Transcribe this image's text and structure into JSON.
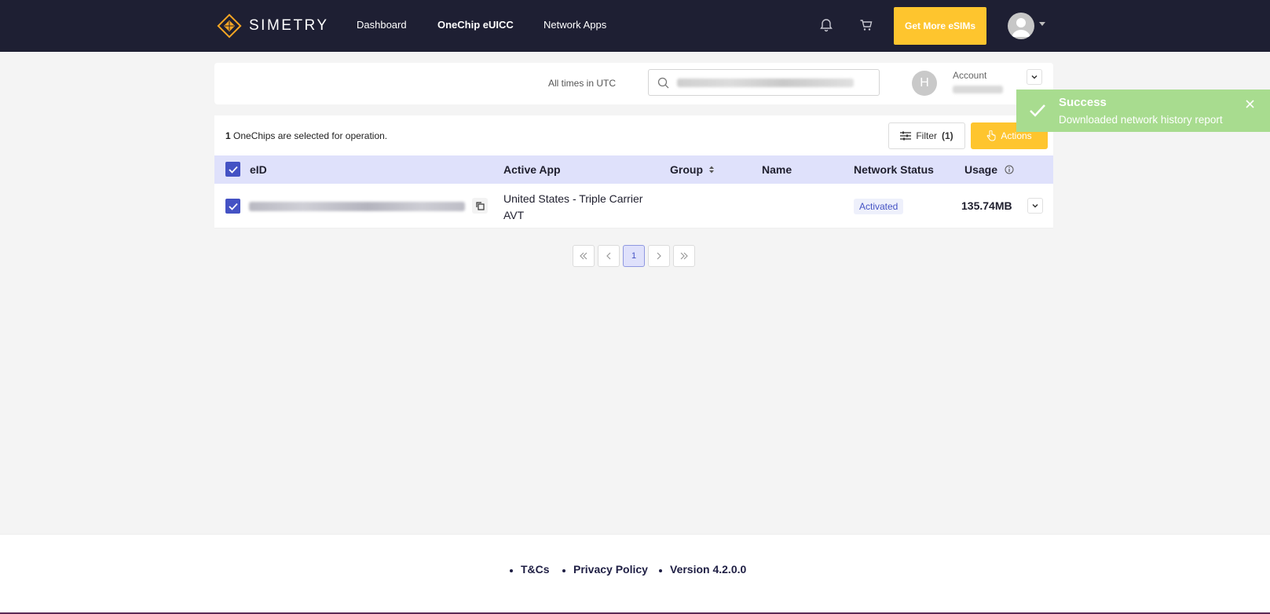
{
  "nav": {
    "brand": "SIMETRY",
    "links": [
      "Dashboard",
      "OneChip eUICC",
      "Network Apps"
    ],
    "active_link": "OneChip eUICC",
    "cta_label": "Get More eSIMs",
    "icons": [
      "bell-icon",
      "cart-icon",
      "user-avatar-icon",
      "caret-down-icon"
    ],
    "brand_color": "#fec52e",
    "bg_color": "#1e1f33"
  },
  "header": {
    "timezone_note": "All times in UTC",
    "account_initial": "H",
    "account_label": "Account"
  },
  "table": {
    "selected_count": "1",
    "selected_suffix": "OneChips are selected for operation.",
    "filter_label": "Filter",
    "filter_count": "(1)",
    "actions_label": "Actions",
    "columns": [
      "eID",
      "Active App",
      "Group",
      "Name",
      "Network Status",
      "Usage"
    ],
    "rows": [
      {
        "active_app": "United States - Triple Carrier AVT",
        "group": "",
        "name": "",
        "network_status": "Activated",
        "usage": "135.74MB"
      }
    ]
  },
  "pagination": {
    "current_page": "1"
  },
  "toast": {
    "title": "Success",
    "message": "Downloaded network history report",
    "color": "#a8dc8f"
  },
  "footer": {
    "links": [
      "T&Cs",
      "Privacy Policy",
      "Version 4.2.0.0"
    ]
  }
}
